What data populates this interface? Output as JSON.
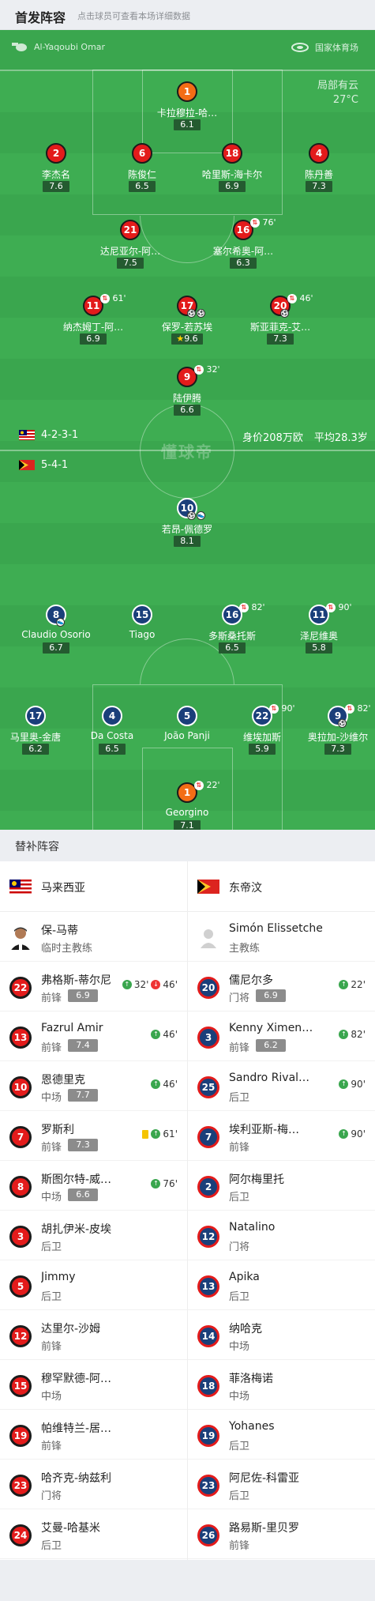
{
  "header": {
    "title": "首发阵容",
    "subtitle": "点击球员可查看本场详细数据"
  },
  "pitch": {
    "referee": "Al-Yaqoubi Omar",
    "stadium": "国家体育场",
    "weather": "局部有云",
    "temp": "27°C",
    "home_formation": "4-2-3-1",
    "away_formation": "5-4-1",
    "market_value": "身价208万欧",
    "avg_age": "平均28.3岁",
    "watermark": "懂球帝",
    "home_players": [
      {
        "num": "1",
        "name": "卡拉穆拉-哈…",
        "rating": "6.1",
        "gk": true
      },
      {
        "num": "2",
        "name": "李杰名",
        "rating": "7.6"
      },
      {
        "num": "6",
        "name": "陈俊仁",
        "rating": "6.5"
      },
      {
        "num": "18",
        "name": "哈里斯-海卡尔",
        "rating": "6.9"
      },
      {
        "num": "4",
        "name": "陈丹善",
        "rating": "7.3"
      },
      {
        "num": "21",
        "name": "达尼亚尔-阿…",
        "rating": "7.5"
      },
      {
        "num": "16",
        "name": "塞尔希奥-阿…",
        "rating": "6.3",
        "sub": "76'"
      },
      {
        "num": "11",
        "name": "纳杰姆丁-阿…",
        "rating": "6.9",
        "sub": "61'"
      },
      {
        "num": "17",
        "name": "保罗-若苏埃",
        "rating": "9.6",
        "goals": 2,
        "star": true
      },
      {
        "num": "20",
        "name": "斯亚菲克-艾…",
        "rating": "7.3",
        "sub": "46'",
        "goals": 1
      },
      {
        "num": "9",
        "name": "陆伊腾",
        "rating": "6.6",
        "sub": "32'"
      }
    ],
    "away_players": [
      {
        "num": "10",
        "name": "若昂-佩德罗",
        "rating": "8.1",
        "goals": 1,
        "assist": true
      },
      {
        "num": "8",
        "name": "Claudio Osorio",
        "rating": "6.7",
        "assist": true
      },
      {
        "num": "15",
        "name": "Tiago",
        "rating": ""
      },
      {
        "num": "16",
        "name": "多斯桑托斯",
        "rating": "6.5",
        "sub": "82'"
      },
      {
        "num": "11",
        "name": "泽尼维奥",
        "rating": "5.8",
        "sub": "90'"
      },
      {
        "num": "17",
        "name": "马里奥-金唐",
        "rating": "6.2"
      },
      {
        "num": "4",
        "name": "Da Costa",
        "rating": "6.5"
      },
      {
        "num": "5",
        "name": "João Panji",
        "rating": ""
      },
      {
        "num": "22",
        "name": "维埃加斯",
        "rating": "5.9",
        "sub": "90'"
      },
      {
        "num": "9",
        "name": "奥拉加-沙维尔",
        "rating": "7.3",
        "sub": "82'",
        "goals": 1
      },
      {
        "num": "1",
        "name": "Georgino",
        "rating": "7.1",
        "sub": "22'",
        "gk": true
      }
    ]
  },
  "subs_section": {
    "title": "替补阵容"
  },
  "home_team": {
    "name": "马来西亚"
  },
  "away_team": {
    "name": "东帝汶"
  },
  "home_coach": {
    "name": "保-马蒂",
    "role": "临时主教练"
  },
  "away_coach": {
    "name": "Simón Elissetche",
    "role": "主教练"
  },
  "home_subs": [
    {
      "num": "22",
      "name": "弗格斯-蒂尔尼",
      "pos": "前锋",
      "rating": "6.9",
      "ev": "32'",
      "ev2": "46'"
    },
    {
      "num": "13",
      "name": "Fazrul Amir",
      "pos": "前锋",
      "rating": "7.4",
      "ev": "46'"
    },
    {
      "num": "10",
      "name": "恩德里克",
      "pos": "中场",
      "rating": "7.7",
      "ev": "46'"
    },
    {
      "num": "7",
      "name": "罗斯利",
      "pos": "前锋",
      "rating": "7.3",
      "ev": "61'",
      "yc": true
    },
    {
      "num": "8",
      "name": "斯图尔特-威…",
      "pos": "中场",
      "rating": "6.6",
      "ev": "76'"
    },
    {
      "num": "3",
      "name": "胡扎伊米-皮埃",
      "pos": "后卫"
    },
    {
      "num": "5",
      "name": "Jimmy",
      "pos": "后卫"
    },
    {
      "num": "12",
      "name": "达里尔-沙姆",
      "pos": "前锋"
    },
    {
      "num": "15",
      "name": "穆罕默德-阿…",
      "pos": "中场"
    },
    {
      "num": "19",
      "name": "帕维特兰-居…",
      "pos": "前锋"
    },
    {
      "num": "23",
      "name": "哈齐克-纳兹利",
      "pos": "门将"
    },
    {
      "num": "24",
      "name": "艾曼-哈基米",
      "pos": "后卫"
    }
  ],
  "away_subs": [
    {
      "num": "20",
      "name": "儒尼尔多",
      "pos": "门将",
      "rating": "6.9",
      "ev": "22'"
    },
    {
      "num": "3",
      "name": "Kenny Ximenes",
      "pos": "前锋",
      "rating": "6.2",
      "ev": "82'"
    },
    {
      "num": "25",
      "name": "Sandro Rival…",
      "pos": "后卫",
      "ev": "90'"
    },
    {
      "num": "7",
      "name": "埃利亚斯-梅…",
      "pos": "前锋",
      "ev": "90'"
    },
    {
      "num": "2",
      "name": "阿尔梅里托",
      "pos": "后卫"
    },
    {
      "num": "12",
      "name": "Natalino",
      "pos": "门将"
    },
    {
      "num": "13",
      "name": "Apika",
      "pos": "后卫"
    },
    {
      "num": "14",
      "name": "纳哈克",
      "pos": "中场"
    },
    {
      "num": "18",
      "name": "菲洛梅诺",
      "pos": "中场"
    },
    {
      "num": "19",
      "name": "Yohanes",
      "pos": "后卫"
    },
    {
      "num": "23",
      "name": "阿尼佐-科雷亚",
      "pos": "后卫"
    },
    {
      "num": "26",
      "name": "路易斯-里贝罗",
      "pos": "前锋"
    }
  ],
  "colors": {
    "pitch": "#3aa64e",
    "home": "#e31b1b",
    "away": "#1a3f7a",
    "gk": "#f36d15"
  }
}
